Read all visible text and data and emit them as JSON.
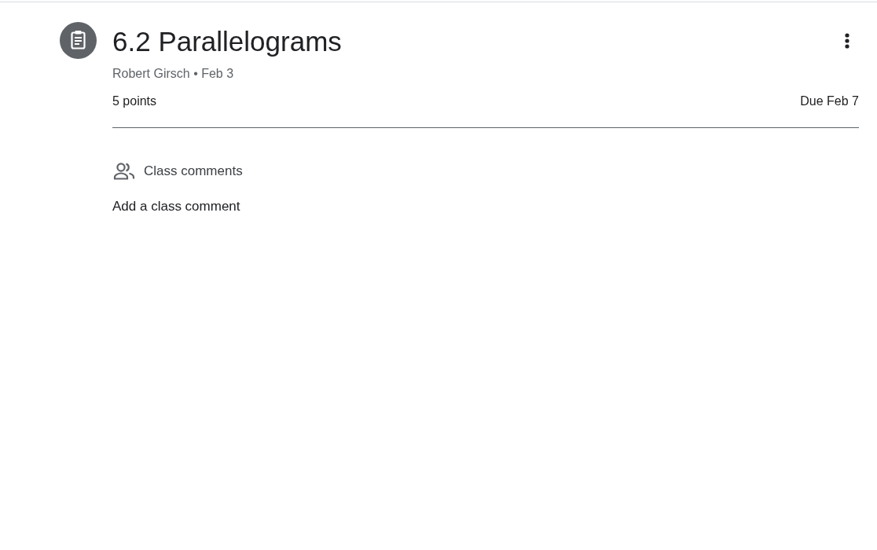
{
  "assignment": {
    "title": "6.2 Parallelograms",
    "meta": "Robert Girsch • Feb 3",
    "points": "5 points",
    "due": "Due Feb 7"
  },
  "class_comments": {
    "heading": "Class comments",
    "add_comment": "Add a class comment"
  }
}
